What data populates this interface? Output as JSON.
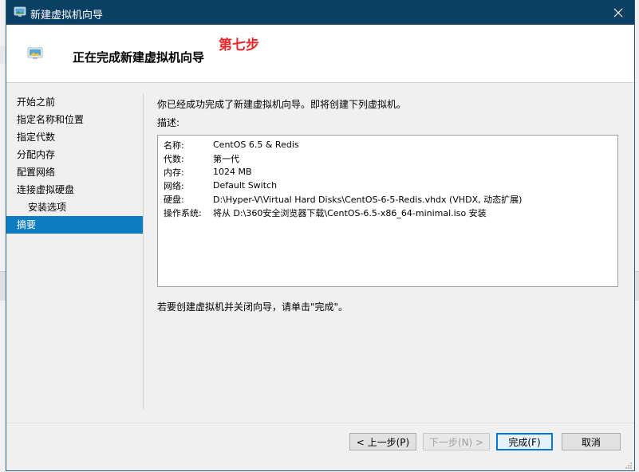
{
  "window": {
    "title": "新建虚拟机向导",
    "close_icon": "close-icon",
    "colors": {
      "titlebar": "#0c3f64",
      "accent": "#0e7cc1",
      "annotation": "#e8262a"
    }
  },
  "header": {
    "title": "正在完成新建虚拟机向导",
    "annotation": "第七步"
  },
  "nav": {
    "items": [
      {
        "label": "开始之前",
        "sub": false,
        "active": false
      },
      {
        "label": "指定名称和位置",
        "sub": false,
        "active": false
      },
      {
        "label": "指定代数",
        "sub": false,
        "active": false
      },
      {
        "label": "分配内存",
        "sub": false,
        "active": false
      },
      {
        "label": "配置网络",
        "sub": false,
        "active": false
      },
      {
        "label": "连接虚拟硬盘",
        "sub": false,
        "active": false
      },
      {
        "label": "安装选项",
        "sub": true,
        "active": false
      },
      {
        "label": "摘要",
        "sub": false,
        "active": true
      }
    ]
  },
  "content": {
    "intro": "你已经成功完成了新建虚拟机向导。即将创建下列虚拟机。",
    "description_label": "描述:",
    "summary": [
      {
        "key": "名称:",
        "value": "CentOS 6.5 & Redis"
      },
      {
        "key": "代数:",
        "value": "第一代"
      },
      {
        "key": "内存:",
        "value": "1024 MB"
      },
      {
        "key": "网络:",
        "value": "Default Switch"
      },
      {
        "key": "硬盘:",
        "value": "D:\\Hyper-V\\Virtual Hard Disks\\CentOS-6-5-Redis.vhdx (VHDX, 动态扩展)"
      },
      {
        "key": "操作系统:",
        "value": "将从 D:\\360安全浏览器下载\\CentOS-6.5-x86_64-minimal.iso 安装"
      }
    ],
    "finish_note": "若要创建虚拟机并关闭向导，请单击\"完成\"。"
  },
  "buttons": {
    "previous": "< 上一步(P)",
    "next": "下一步(N) >",
    "finish": "完成(F)",
    "cancel": "取消"
  }
}
